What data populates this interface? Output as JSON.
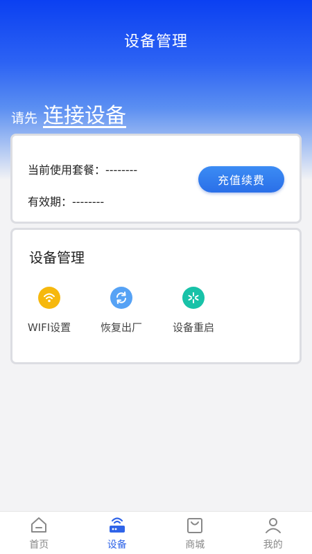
{
  "header": {
    "title": "设备管理"
  },
  "connect": {
    "prefix": "请先",
    "link": "连接设备"
  },
  "plan": {
    "current_label": "当前使用套餐：--------",
    "validity_label": "有效期：--------",
    "recharge_button": "充值续费"
  },
  "manage": {
    "title": "设备管理",
    "tools": [
      {
        "label": "WIFI设置",
        "icon": "wifi-icon",
        "color": "#f6b80e"
      },
      {
        "label": "恢复出厂",
        "icon": "refresh-icon",
        "color": "#56a2f5"
      },
      {
        "label": "设备重启",
        "icon": "restart-icon",
        "color": "#18c2a8"
      }
    ]
  },
  "tabs": [
    {
      "label": "首页",
      "icon": "home-icon",
      "active": false
    },
    {
      "label": "设备",
      "icon": "router-icon",
      "active": true
    },
    {
      "label": "商城",
      "icon": "shopping-bag-icon",
      "active": false
    },
    {
      "label": "我的",
      "icon": "user-icon",
      "active": false
    }
  ],
  "colors": {
    "accent": "#2f64e8",
    "header_top": "#0b40f2",
    "background": "#f3f3f5"
  }
}
